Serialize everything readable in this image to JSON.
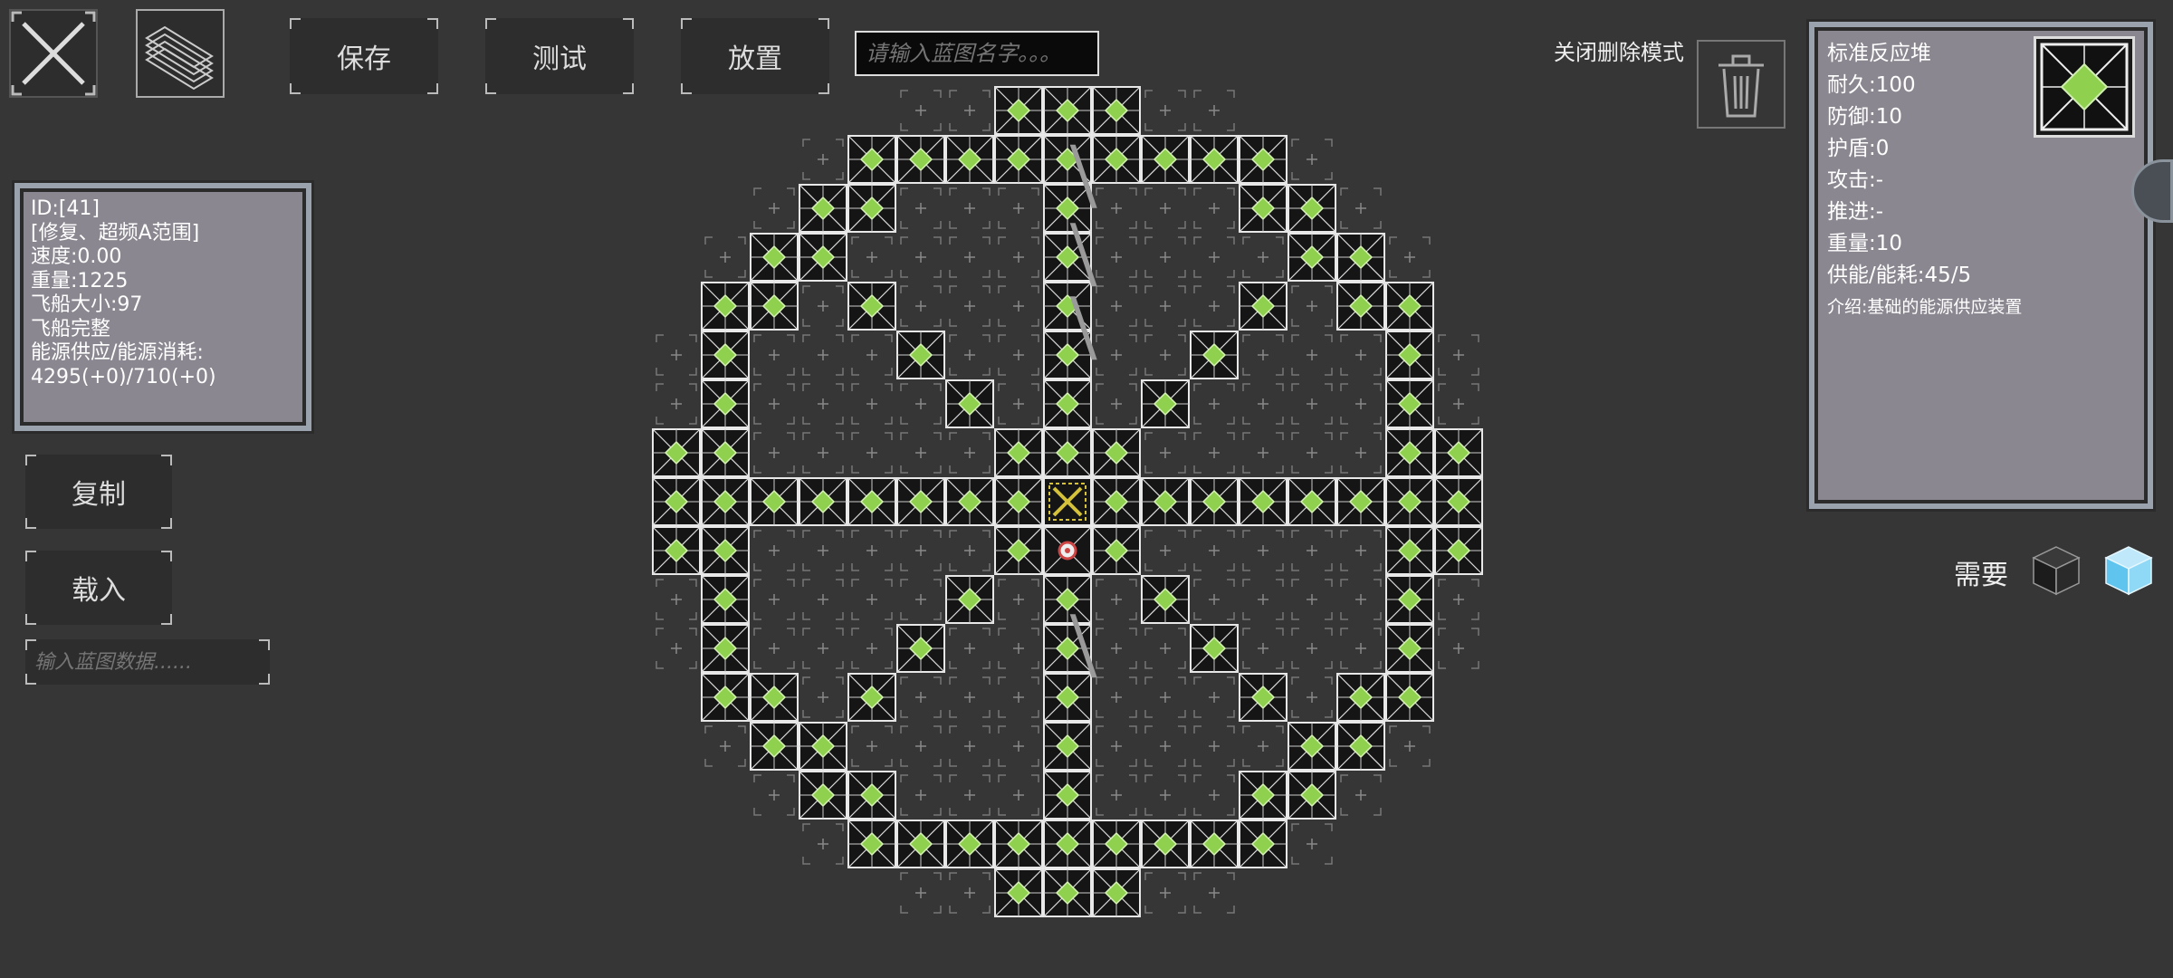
{
  "toolbar": {
    "save_label": "保存",
    "test_label": "测试",
    "place_label": "放置",
    "blueprint_name_placeholder": "请输入蓝图名字。。。"
  },
  "delete_mode": {
    "label": "关闭删除模式"
  },
  "ship_info": {
    "lines": [
      "ID:[41]",
      "[修复、超频A范围]",
      "速度:0.00",
      "重量:1225",
      "飞船大小:97",
      "飞船完整",
      "能源供应/能源消耗:",
      "4295(+0)/710(+0)"
    ]
  },
  "left_actions": {
    "copy_label": "复制",
    "load_label": "载入",
    "data_placeholder": "输入蓝图数据......"
  },
  "part_info": {
    "name": "标准反应堆",
    "durability": "耐久:100",
    "defense": "防御:10",
    "shield": "护盾:0",
    "attack": "攻击:-",
    "thrust": "推进:-",
    "weight": "重量:10",
    "energy": "供能/能耗:45/5",
    "description": "介绍:基础的能源供应装置"
  },
  "requirements": {
    "label": "需要",
    "items": [
      "dark-cube-icon",
      "blue-cube-icon"
    ]
  },
  "colors": {
    "background": "#363636",
    "cell_green": "#8fd14f",
    "panel": "#8b8790",
    "panel_frame": "#9aa3ad",
    "core_yellow": "#d6c23a"
  }
}
